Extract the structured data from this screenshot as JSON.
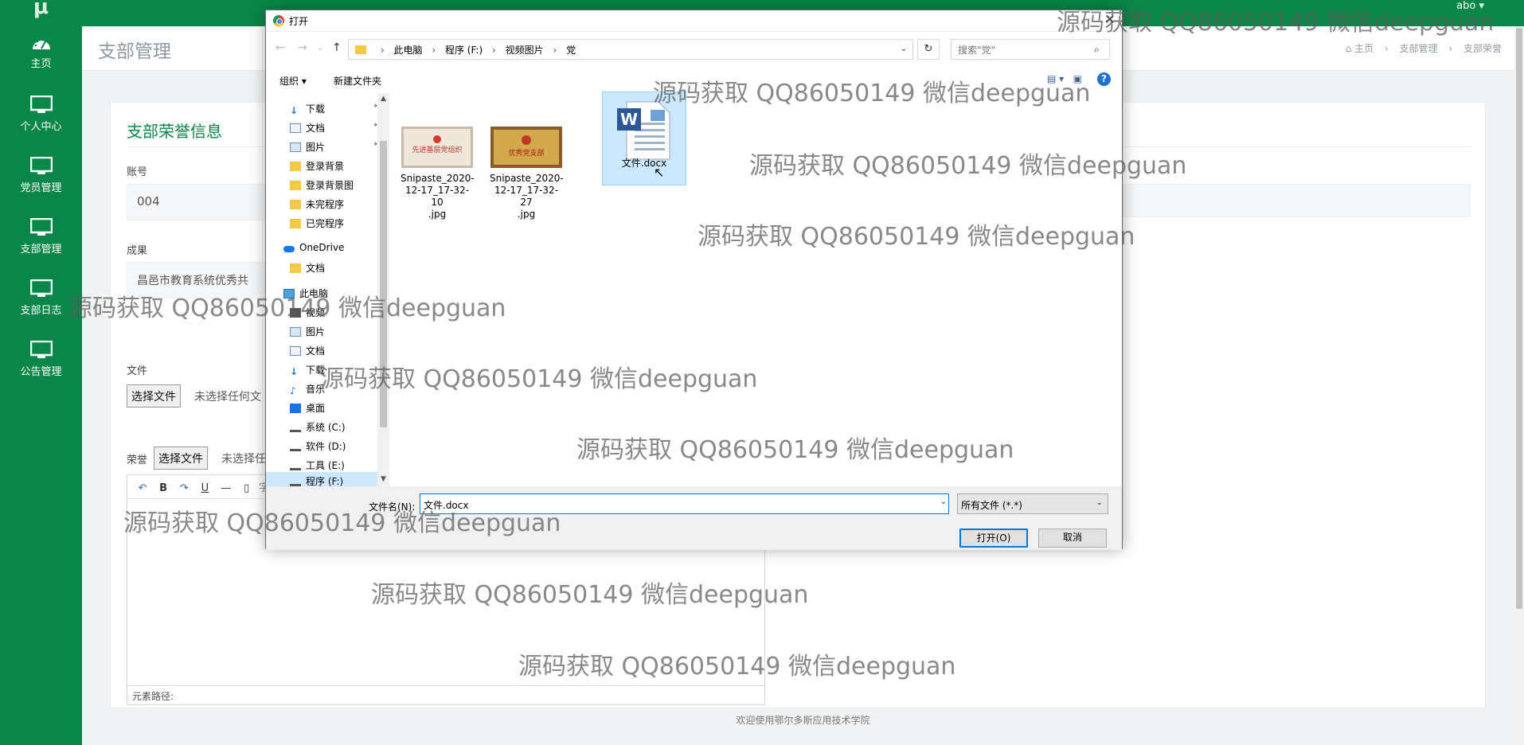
{
  "app": {
    "logo": "μ",
    "user": "abo ▾"
  },
  "sidebar": {
    "items": [
      {
        "label": "主页",
        "icon": "dashboard-icon"
      },
      {
        "label": "个人中心",
        "icon": "monitor-icon"
      },
      {
        "label": "党员管理",
        "icon": "monitor-icon"
      },
      {
        "label": "支部管理",
        "icon": "monitor-icon"
      },
      {
        "label": "支部日志",
        "icon": "monitor-icon"
      },
      {
        "label": "公告管理",
        "icon": "monitor-icon"
      }
    ]
  },
  "header": {
    "title": "支部管理",
    "breadcrumb": [
      "主页",
      "支部管理",
      "支部荣誉"
    ]
  },
  "form": {
    "title": "支部荣誉信息",
    "account_label": "账号",
    "account_value": "004",
    "result_label": "成果",
    "result_value": "昌邑市教育系统优秀共",
    "file_label": "文件",
    "choose_file": "选择文件",
    "no_file": "未选择任何文",
    "honor_label": "荣誉",
    "honor_choose": "选择文件",
    "honor_no_file": "未选择任",
    "editor_toolbar": [
      "B",
      "U",
      "—"
    ],
    "editor_font": "字体",
    "editor_path": "元素路径:"
  },
  "footer": "欢迎使用鄂尔多斯应用技术学院",
  "dialog": {
    "title": "打开",
    "path": [
      "此电脑",
      "程序 (F:)",
      "视频图片",
      "党"
    ],
    "search_placeholder": "搜索\"党\"",
    "organize": "组织 ▾",
    "new_folder": "新建文件夹",
    "nav": [
      {
        "label": "下载",
        "icon": "download-icon",
        "pinned": true
      },
      {
        "label": "文档",
        "icon": "document-icon",
        "pinned": true
      },
      {
        "label": "图片",
        "icon": "picture-icon",
        "pinned": true
      },
      {
        "label": "登录背景",
        "icon": "folder-icon"
      },
      {
        "label": "登录背景图",
        "icon": "folder-icon"
      },
      {
        "label": "未完程序",
        "icon": "folder-icon"
      },
      {
        "label": "已完程序",
        "icon": "folder-icon"
      },
      {
        "label": "OneDrive",
        "icon": "cloud-icon"
      },
      {
        "label": "文档",
        "icon": "folder-icon"
      },
      {
        "label": "此电脑",
        "icon": "computer-icon"
      },
      {
        "label": "视频",
        "icon": "video-icon"
      },
      {
        "label": "图片",
        "icon": "picture-icon"
      },
      {
        "label": "文档",
        "icon": "document-icon"
      },
      {
        "label": "下载",
        "icon": "download-icon"
      },
      {
        "label": "音乐",
        "icon": "music-icon"
      },
      {
        "label": "桌面",
        "icon": "desktop-icon"
      },
      {
        "label": "系统 (C:)",
        "icon": "drive-icon"
      },
      {
        "label": "软件 (D:)",
        "icon": "drive-icon"
      },
      {
        "label": "工具 (E:)",
        "icon": "drive-icon"
      },
      {
        "label": "程序 (F:)",
        "icon": "drive-icon"
      }
    ],
    "files": [
      {
        "name": "Snipaste_2020-12-17_17-32-10.jpg",
        "line1": "Snipaste_2020-",
        "line2": "12-17_17-32-10",
        "line3": ".jpg",
        "thumb_text": "先进基层党组织"
      },
      {
        "name": "Snipaste_2020-12-17_17-32-27.jpg",
        "line1": "Snipaste_2020-",
        "line2": "12-17_17-32-27",
        "line3": ".jpg",
        "thumb_text": "优秀党支部"
      },
      {
        "name": "文件.docx",
        "line1": "文件.docx",
        "line2": "",
        "line3": ""
      }
    ],
    "filename_label": "文件名(N):",
    "filename_value": "文件.docx",
    "filetype": "所有文件 (*.*)",
    "open": "打开(O)",
    "cancel": "取消"
  },
  "watermarks": [
    "源码获取 QQ86050149 微信deepguan",
    "源码获取 QQ86050149 微信deepguan",
    "源码获取 QQ86050149 微信deepguan",
    "源码获取 QQ86050149 微信deepguan",
    "源码获取 QQ86050149 微信deepguan",
    "源码获取 QQ86050149 微信deepguan",
    "源码获取 QQ86050149 微信deepguan",
    "源码获取 QQ86050149 微信deepguan",
    "源码获取 QQ86050149 微信deepguan",
    "源码获取 QQ86050149 微信deepguan"
  ],
  "colors": {
    "brand": "#0a8748",
    "selection": "#cce8ff",
    "accent": "#0078d7"
  }
}
